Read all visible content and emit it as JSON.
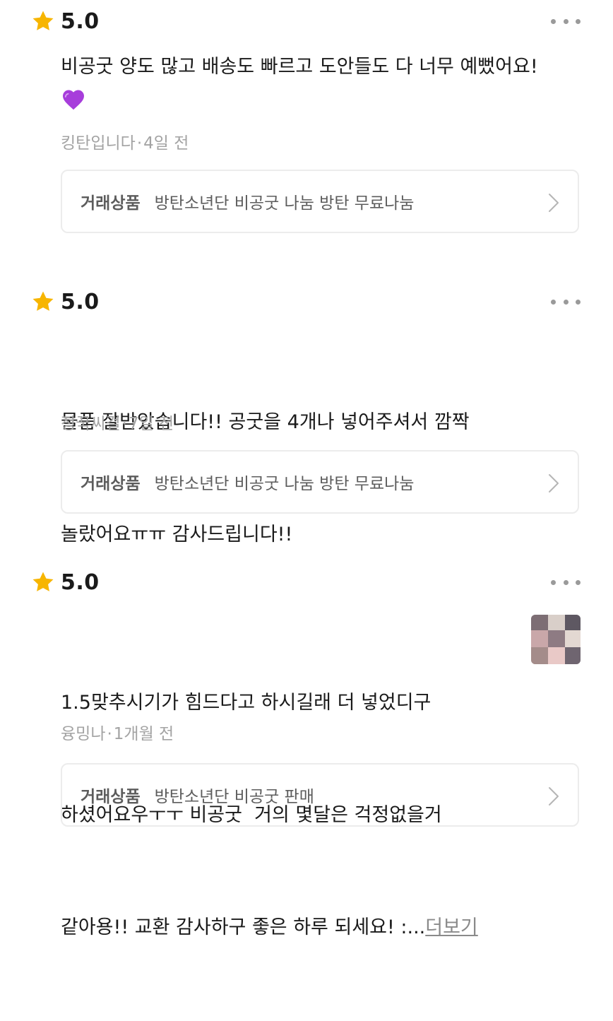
{
  "reviews": [
    {
      "rating": "5.0",
      "text": "비공굿 양도 많고 배송도 빠르고 도안들도 다 너무 예뻤어요!",
      "emoji": "purple-heart",
      "author": "킹탄입니다",
      "separator": "·",
      "time": "4일 전",
      "product_label": "거래상품",
      "product_name": "방탄소년단 비공굿 나눔 방탄 무료나눔"
    },
    {
      "rating": "5.0",
      "text_lines": [
        "물품 잘받았습니다!! 공굿을 4개나 넣어주셔서 깜짝",
        "놀랐어요ㅠㅠ 감사드립니다!!"
      ],
      "author": "정꾹씨걸",
      "separator": "·",
      "time": "7일 전",
      "product_label": "거래상품",
      "product_name": "방탄소년단 비공굿 나눔 방탄 무료나눔"
    },
    {
      "rating": "5.0",
      "text_lines": [
        "1.5맞추시기가 힘드다고 하시길래 더 넣었디구",
        "하셨어요우ㅜㅜ 비공굿  거의 몇달은 걱정없을거",
        "같아용!! 교환 감사하구 좋은 하루 되세요! :..."
      ],
      "more_label": "더보기",
      "author": "융밍나",
      "separator": "·",
      "time": "1개월 전",
      "product_label": "거래상품",
      "product_name": "방탄소년단 비공굿 판매",
      "thumbnail": "review-photo"
    }
  ],
  "icons": {
    "star": "star-icon",
    "more": "more-dots-icon",
    "chevron": "chevron-right-icon"
  },
  "colors": {
    "star": "#F7B500",
    "text": "#1A1A1A",
    "meta": "#A3A3A3",
    "border": "#ECECEC",
    "heart": "#A73DDB"
  }
}
